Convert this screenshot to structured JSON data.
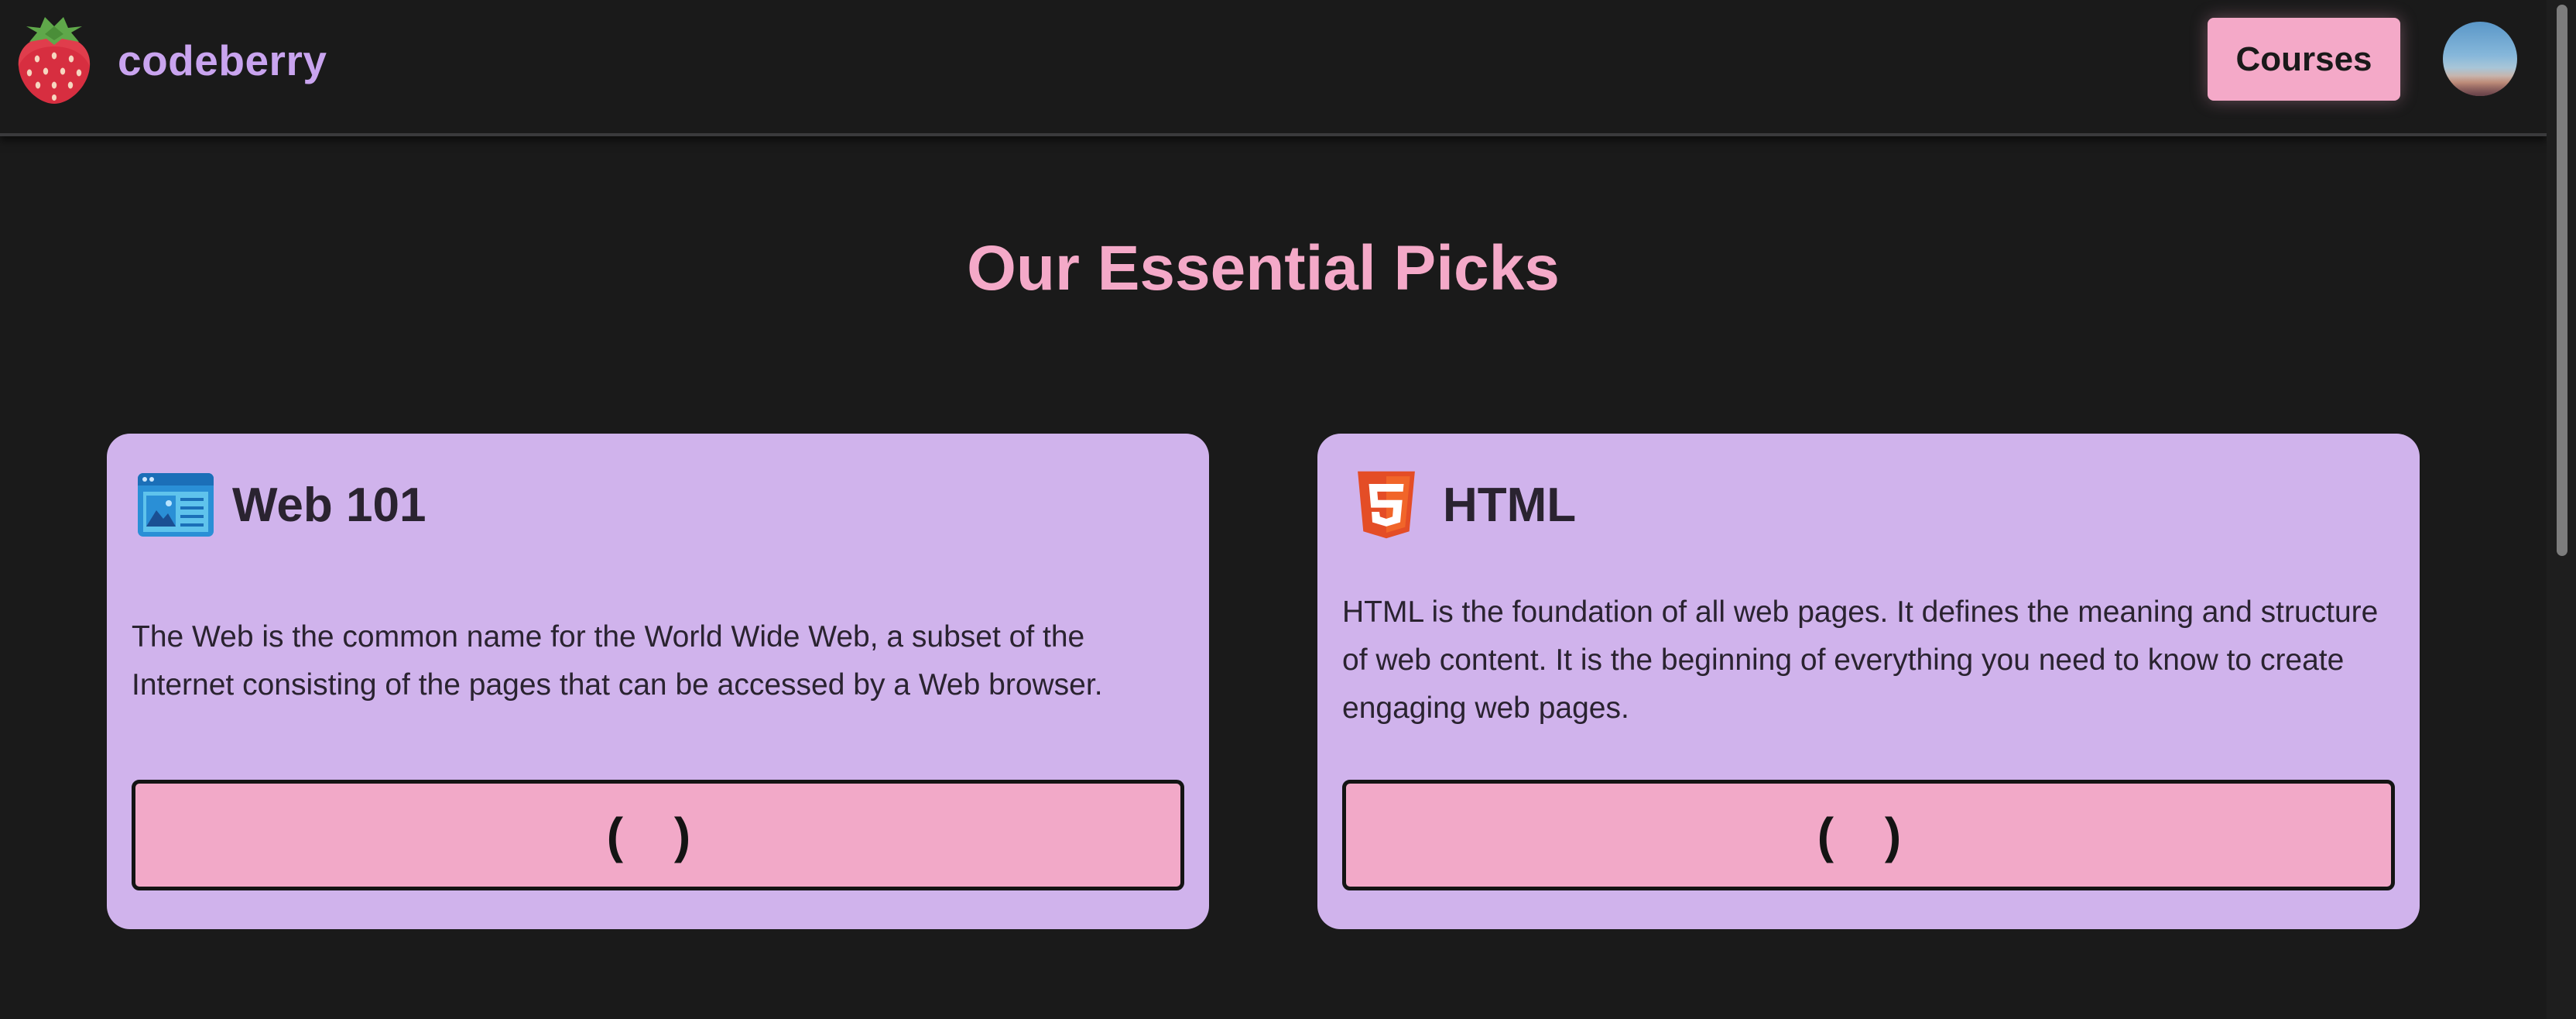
{
  "header": {
    "brand_name": "codeberry",
    "logo_icon": "strawberry-icon",
    "courses_label": "Courses",
    "avatar_icon": "user-avatar"
  },
  "main": {
    "title": "Our Essential Picks",
    "cards": [
      {
        "icon": "web-page-icon",
        "title": "Web 101",
        "description": "The Web is the common name for the World Wide Web, a subset of the Internet consisting of the pages that can be accessed by a Web browser.",
        "button_label": "( )"
      },
      {
        "icon": "html5-icon",
        "title": "HTML",
        "description": "HTML is the foundation of all web pages. It defines the meaning and structure of web content. It is the beginning of everything you need to know to create engaging web pages.",
        "button_label": "( )"
      }
    ]
  },
  "colors": {
    "background": "#1a1a1a",
    "brand": "#c9a4ef",
    "accent_pink": "#f4a9c8",
    "card_bg": "#d0b3ec",
    "text_dark": "#2a2330"
  }
}
